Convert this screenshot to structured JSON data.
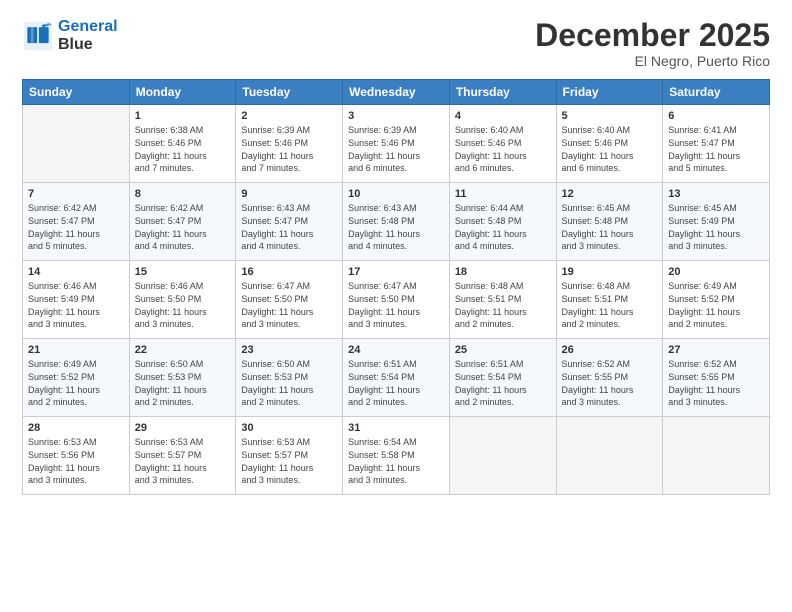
{
  "header": {
    "logo_line1": "General",
    "logo_line2": "Blue",
    "month": "December 2025",
    "location": "El Negro, Puerto Rico"
  },
  "days_of_week": [
    "Sunday",
    "Monday",
    "Tuesday",
    "Wednesday",
    "Thursday",
    "Friday",
    "Saturday"
  ],
  "weeks": [
    [
      {
        "day": "",
        "info": ""
      },
      {
        "day": "1",
        "info": "Sunrise: 6:38 AM\nSunset: 5:46 PM\nDaylight: 11 hours\nand 7 minutes."
      },
      {
        "day": "2",
        "info": "Sunrise: 6:39 AM\nSunset: 5:46 PM\nDaylight: 11 hours\nand 7 minutes."
      },
      {
        "day": "3",
        "info": "Sunrise: 6:39 AM\nSunset: 5:46 PM\nDaylight: 11 hours\nand 6 minutes."
      },
      {
        "day": "4",
        "info": "Sunrise: 6:40 AM\nSunset: 5:46 PM\nDaylight: 11 hours\nand 6 minutes."
      },
      {
        "day": "5",
        "info": "Sunrise: 6:40 AM\nSunset: 5:46 PM\nDaylight: 11 hours\nand 6 minutes."
      },
      {
        "day": "6",
        "info": "Sunrise: 6:41 AM\nSunset: 5:47 PM\nDaylight: 11 hours\nand 5 minutes."
      }
    ],
    [
      {
        "day": "7",
        "info": "Sunrise: 6:42 AM\nSunset: 5:47 PM\nDaylight: 11 hours\nand 5 minutes."
      },
      {
        "day": "8",
        "info": "Sunrise: 6:42 AM\nSunset: 5:47 PM\nDaylight: 11 hours\nand 4 minutes."
      },
      {
        "day": "9",
        "info": "Sunrise: 6:43 AM\nSunset: 5:47 PM\nDaylight: 11 hours\nand 4 minutes."
      },
      {
        "day": "10",
        "info": "Sunrise: 6:43 AM\nSunset: 5:48 PM\nDaylight: 11 hours\nand 4 minutes."
      },
      {
        "day": "11",
        "info": "Sunrise: 6:44 AM\nSunset: 5:48 PM\nDaylight: 11 hours\nand 4 minutes."
      },
      {
        "day": "12",
        "info": "Sunrise: 6:45 AM\nSunset: 5:48 PM\nDaylight: 11 hours\nand 3 minutes."
      },
      {
        "day": "13",
        "info": "Sunrise: 6:45 AM\nSunset: 5:49 PM\nDaylight: 11 hours\nand 3 minutes."
      }
    ],
    [
      {
        "day": "14",
        "info": "Sunrise: 6:46 AM\nSunset: 5:49 PM\nDaylight: 11 hours\nand 3 minutes."
      },
      {
        "day": "15",
        "info": "Sunrise: 6:46 AM\nSunset: 5:50 PM\nDaylight: 11 hours\nand 3 minutes."
      },
      {
        "day": "16",
        "info": "Sunrise: 6:47 AM\nSunset: 5:50 PM\nDaylight: 11 hours\nand 3 minutes."
      },
      {
        "day": "17",
        "info": "Sunrise: 6:47 AM\nSunset: 5:50 PM\nDaylight: 11 hours\nand 3 minutes."
      },
      {
        "day": "18",
        "info": "Sunrise: 6:48 AM\nSunset: 5:51 PM\nDaylight: 11 hours\nand 2 minutes."
      },
      {
        "day": "19",
        "info": "Sunrise: 6:48 AM\nSunset: 5:51 PM\nDaylight: 11 hours\nand 2 minutes."
      },
      {
        "day": "20",
        "info": "Sunrise: 6:49 AM\nSunset: 5:52 PM\nDaylight: 11 hours\nand 2 minutes."
      }
    ],
    [
      {
        "day": "21",
        "info": "Sunrise: 6:49 AM\nSunset: 5:52 PM\nDaylight: 11 hours\nand 2 minutes."
      },
      {
        "day": "22",
        "info": "Sunrise: 6:50 AM\nSunset: 5:53 PM\nDaylight: 11 hours\nand 2 minutes."
      },
      {
        "day": "23",
        "info": "Sunrise: 6:50 AM\nSunset: 5:53 PM\nDaylight: 11 hours\nand 2 minutes."
      },
      {
        "day": "24",
        "info": "Sunrise: 6:51 AM\nSunset: 5:54 PM\nDaylight: 11 hours\nand 2 minutes."
      },
      {
        "day": "25",
        "info": "Sunrise: 6:51 AM\nSunset: 5:54 PM\nDaylight: 11 hours\nand 2 minutes."
      },
      {
        "day": "26",
        "info": "Sunrise: 6:52 AM\nSunset: 5:55 PM\nDaylight: 11 hours\nand 3 minutes."
      },
      {
        "day": "27",
        "info": "Sunrise: 6:52 AM\nSunset: 5:55 PM\nDaylight: 11 hours\nand 3 minutes."
      }
    ],
    [
      {
        "day": "28",
        "info": "Sunrise: 6:53 AM\nSunset: 5:56 PM\nDaylight: 11 hours\nand 3 minutes."
      },
      {
        "day": "29",
        "info": "Sunrise: 6:53 AM\nSunset: 5:57 PM\nDaylight: 11 hours\nand 3 minutes."
      },
      {
        "day": "30",
        "info": "Sunrise: 6:53 AM\nSunset: 5:57 PM\nDaylight: 11 hours\nand 3 minutes."
      },
      {
        "day": "31",
        "info": "Sunrise: 6:54 AM\nSunset: 5:58 PM\nDaylight: 11 hours\nand 3 minutes."
      },
      {
        "day": "",
        "info": ""
      },
      {
        "day": "",
        "info": ""
      },
      {
        "day": "",
        "info": ""
      }
    ]
  ]
}
